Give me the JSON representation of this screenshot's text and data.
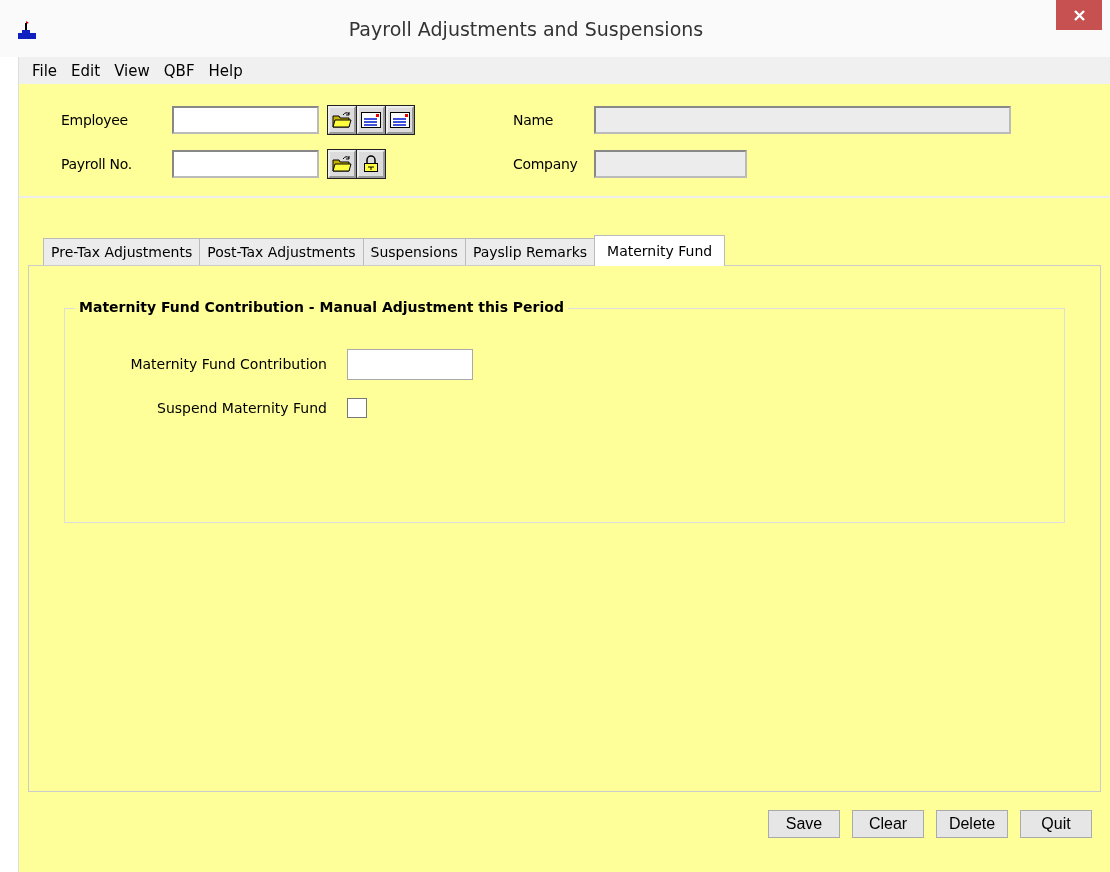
{
  "window": {
    "title": "Payroll Adjustments and Suspensions"
  },
  "menu": [
    "File",
    "Edit",
    "View",
    "QBF",
    "Help"
  ],
  "header": {
    "rows": [
      {
        "label": "Employee",
        "tools": [
          {
            "kind": "folder"
          },
          {
            "kind": "card"
          },
          {
            "kind": "card"
          }
        ],
        "side_label": "Name",
        "side_field": {
          "kind": "wide"
        }
      },
      {
        "label": "Payroll No.",
        "tools": [
          {
            "kind": "folder"
          },
          {
            "kind": "lock"
          }
        ],
        "side_label": "Company",
        "side_field": {
          "kind": "narrow"
        }
      }
    ]
  },
  "tabs": [
    {
      "label": "Pre-Tax Adjustments",
      "selected": false
    },
    {
      "label": "Post-Tax Adjustments",
      "selected": false
    },
    {
      "label": "Suspensions",
      "selected": false
    },
    {
      "label": "Payslip Remarks",
      "selected": false
    },
    {
      "label": "Maternity Fund",
      "selected": true
    }
  ],
  "group": {
    "title": "Maternity Fund Contribution - Manual Adjustment this Period",
    "fields": [
      {
        "kind": "text",
        "label": "Maternity Fund Contribution"
      },
      {
        "kind": "checkbox",
        "label": "Suspend Maternity Fund",
        "checked": false
      }
    ]
  },
  "buttons": [
    "Save",
    "Clear",
    "Delete",
    "Quit"
  ]
}
